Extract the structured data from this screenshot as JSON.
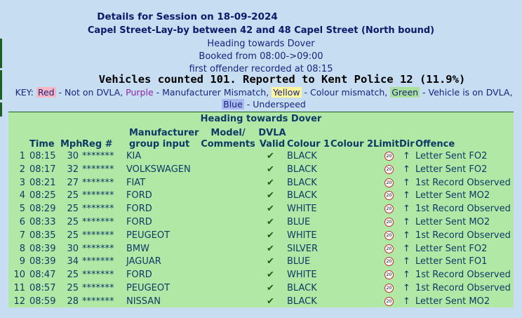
{
  "session": {
    "title": "Details for Session on 18-09-2024",
    "location": "Capel Street-Lay-by between 42 and 48 Capel Street (North bound)",
    "heading": "Heading towards Dover",
    "booked": "Booked from 08:00->09:00",
    "first_offender": "first offender recorded at 08:15",
    "counted": "Vehicles counted 101. Reported to Kent Police 12  (11.9%)"
  },
  "key": {
    "prefix": "KEY: ",
    "red_label": "Red",
    "red_desc": " - Not on DVLA, ",
    "purple_label": "Purple",
    "purple_desc": " - Manufacturer Mismatch, ",
    "yellow_label": "Yellow",
    "yellow_desc": " - Colour mismatch, ",
    "green_label": "Green",
    "green_desc": " - Vehicle is on DVLA,",
    "blue_label": "Blue",
    "blue_desc": " - Underspeed",
    "colors": {
      "red": "#f4b6c2",
      "purple": "#8e24aa",
      "yellow": "#fff59d",
      "green": "#a8e09c",
      "blue": "#aab8f0"
    }
  },
  "table": {
    "panel_title": "Heading towards Dover",
    "headers": {
      "time": "Time",
      "mph": "Mph",
      "reg": "Reg #",
      "manufacturer_1": "Manufacturer",
      "manufacturer_2": "group input",
      "model_1": "Model/",
      "model_2": "Comments",
      "dvla_1": "DVLA",
      "dvla_2": "Valid",
      "colour1": "Colour 1",
      "colour2": "Colour 2",
      "limit": "Limit",
      "dir": "Dir",
      "offence": "Offence"
    },
    "limit_icon": "speed-limit-20-sign",
    "rows": [
      {
        "n": "1",
        "time": "08:15",
        "mph": "30",
        "reg": "*******",
        "make": "KIA",
        "dvla": "✔",
        "colour1": "BLACK",
        "limit": "20",
        "dir": "↑",
        "offence": "Letter Sent FO2"
      },
      {
        "n": "2",
        "time": "08:17",
        "mph": "32",
        "reg": "*******",
        "make": "VOLKSWAGEN",
        "dvla": "✔",
        "colour1": "BLACK",
        "limit": "20",
        "dir": "↑",
        "offence": "Letter Sent FO2"
      },
      {
        "n": "3",
        "time": "08:21",
        "mph": "27",
        "reg": "*******",
        "make": "FIAT",
        "dvla": "✔",
        "colour1": "BLACK",
        "limit": "20",
        "dir": "↑",
        "offence": "1st Record Observed"
      },
      {
        "n": "4",
        "time": "08:25",
        "mph": "25",
        "reg": "*******",
        "make": "FORD",
        "dvla": "✔",
        "colour1": "BLACK",
        "limit": "20",
        "dir": "↑",
        "offence": "Letter Sent MO2"
      },
      {
        "n": "5",
        "time": "08:29",
        "mph": "25",
        "reg": "*******",
        "make": "FORD",
        "dvla": "✔",
        "colour1": "WHITE",
        "limit": "20",
        "dir": "↑",
        "offence": "1st Record Observed"
      },
      {
        "n": "6",
        "time": "08:33",
        "mph": "25",
        "reg": "*******",
        "make": "FORD",
        "dvla": "✔",
        "colour1": "BLUE",
        "limit": "20",
        "dir": "↑",
        "offence": "Letter Sent MO2"
      },
      {
        "n": "7",
        "time": "08:35",
        "mph": "25",
        "reg": "*******",
        "make": "PEUGEOT",
        "dvla": "✔",
        "colour1": "WHITE",
        "limit": "20",
        "dir": "↑",
        "offence": "1st Record Observed"
      },
      {
        "n": "8",
        "time": "08:39",
        "mph": "30",
        "reg": "*******",
        "make": "BMW",
        "dvla": "✔",
        "colour1": "SILVER",
        "limit": "20",
        "dir": "↑",
        "offence": "Letter Sent FO2"
      },
      {
        "n": "9",
        "time": "08:39",
        "mph": "34",
        "reg": "*******",
        "make": "JAGUAR",
        "dvla": "✔",
        "colour1": "BLUE",
        "limit": "20",
        "dir": "↑",
        "offence": "Letter Sent FO1"
      },
      {
        "n": "10",
        "time": "08:47",
        "mph": "25",
        "reg": "*******",
        "make": "FORD",
        "dvla": "✔",
        "colour1": "WHITE",
        "limit": "20",
        "dir": "↑",
        "offence": "1st Record Observed"
      },
      {
        "n": "11",
        "time": "08:57",
        "mph": "25",
        "reg": "*******",
        "make": "PEUGEOT",
        "dvla": "✔",
        "colour1": "BLACK",
        "limit": "20",
        "dir": "↑",
        "offence": "1st Record Observed"
      },
      {
        "n": "12",
        "time": "08:59",
        "mph": "28",
        "reg": "*******",
        "make": "NISSAN",
        "dvla": "✔",
        "colour1": "BLACK",
        "limit": "20",
        "dir": "↑",
        "offence": "Letter Sent MO2"
      }
    ]
  }
}
